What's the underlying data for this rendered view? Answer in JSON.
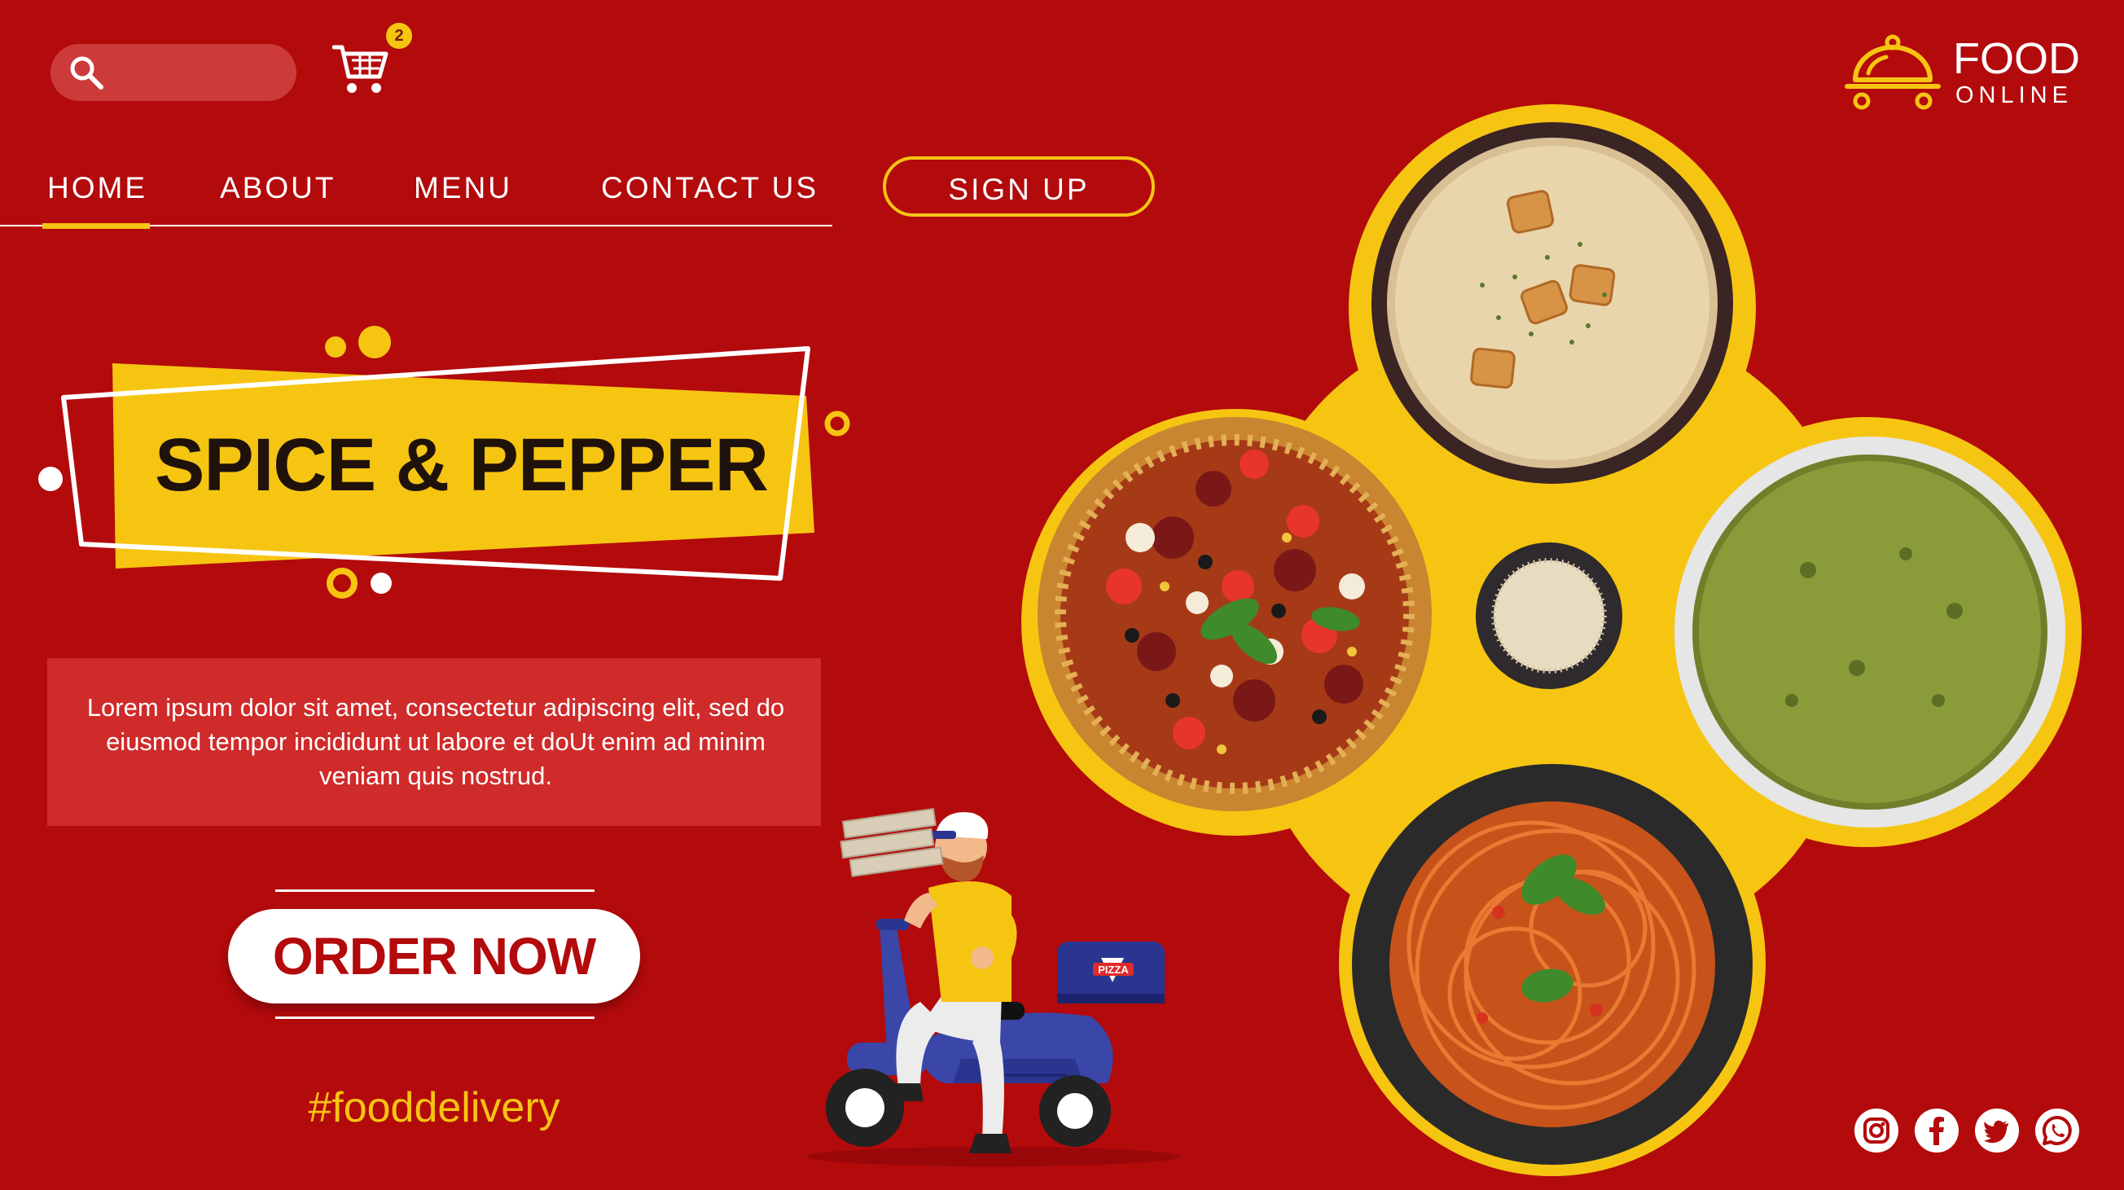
{
  "header": {
    "search": {
      "placeholder": "",
      "value": ""
    },
    "cart": {
      "count": "2"
    }
  },
  "logo": {
    "line1": "FOOD",
    "line2": "ONLINE"
  },
  "nav": {
    "items": [
      {
        "label": "HOME",
        "active": true
      },
      {
        "label": "ABOUT",
        "active": false
      },
      {
        "label": "MENU",
        "active": false
      },
      {
        "label": "CONTACT US",
        "active": false
      }
    ],
    "signup_label": "SIGN UP"
  },
  "hero": {
    "title": "SPICE & PEPPER",
    "description": "Lorem ipsum dolor sit amet, consectetur adipiscing elit, sed do eiusmod tempor incididunt ut labore et doUt enim ad minim veniam quis nostrud.",
    "order_label": "ORDER NOW",
    "hashtag": "#fooddelivery",
    "box_label": "PIZZA"
  },
  "social": [
    "instagram-icon",
    "facebook-icon",
    "twitter-icon",
    "whatsapp-icon"
  ],
  "colors": {
    "background": "#b30a0c",
    "accent": "#f6c512",
    "text_dark": "#1f120b",
    "panel": "#cf2b2b",
    "white": "#ffffff"
  }
}
